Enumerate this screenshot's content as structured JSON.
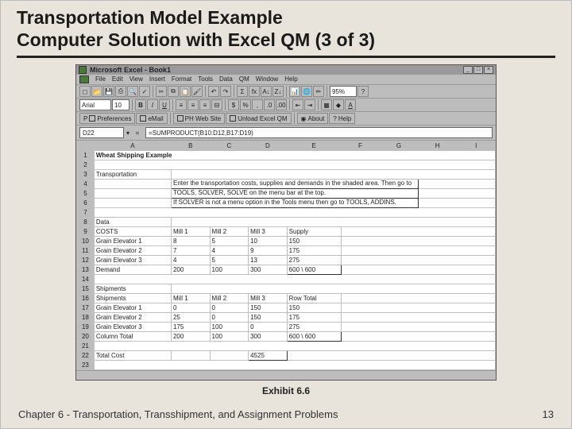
{
  "slide": {
    "title_line1": "Transportation Model Example",
    "title_line2": "Computer Solution with Excel QM (3 of 3)",
    "exhibit": "Exhibit 6.6",
    "footer_left": "Chapter 6 - Transportation, Transshipment, and Assignment Problems",
    "footer_right": "13"
  },
  "excel": {
    "app_title": "Microsoft Excel - Book1",
    "menu": [
      "File",
      "Edit",
      "View",
      "Insert",
      "Format",
      "Tools",
      "Data",
      "QM",
      "Window",
      "Help"
    ],
    "zoom": "95%",
    "font_name": "Arial",
    "font_size": "10",
    "links": {
      "preferences": "Preferences",
      "email": "eMail",
      "ph": "PH Web Site",
      "excel": "Unload Excel QM",
      "about": "About",
      "help": "Help"
    },
    "cell_ref": "D22",
    "formula": "=SUMPRODUCT(B10:D12,B17:D19)",
    "cols": [
      "A",
      "B",
      "C",
      "D",
      "E",
      "F",
      "G",
      "H",
      "I"
    ],
    "rows": {
      "1": {
        "A": "Wheat Shipping Example",
        "bold": true
      },
      "3": {
        "A": "Transportation"
      },
      "4": {
        "B": "Enter the transportation costs, supplies and demands in the shaded area. Then go to"
      },
      "5": {
        "B": "TOOLS, SOLVER, SOLVE on the menu bar at the top."
      },
      "6": {
        "B": "If SOLVER is not a menu option in the Tools menu then go to TOOLS, ADDINS."
      },
      "8": {
        "A": "Data"
      },
      "9": {
        "A": "COSTS",
        "B": "Mill 1",
        "C": "Mill 2",
        "D": "Mill 3",
        "E": "Supply"
      },
      "10": {
        "A": "Grain Elevator 1",
        "B": "8",
        "C": "5",
        "D": "10",
        "E": "150"
      },
      "11": {
        "A": "Grain Elevator 2",
        "B": "7",
        "C": "4",
        "D": "9",
        "E": "175"
      },
      "12": {
        "A": "Grain Elevator 3",
        "B": "4",
        "C": "5",
        "D": "13",
        "E": "275"
      },
      "13": {
        "A": "Demand",
        "B": "200",
        "C": "100",
        "D": "300",
        "E": "600 \\ 600"
      },
      "15": {
        "A": "Shipments"
      },
      "16": {
        "A": "Shipments",
        "B": "Mill 1",
        "C": "Mill 2",
        "D": "Mill 3",
        "E": "Row Total"
      },
      "17": {
        "A": "Grain Elevator 1",
        "B": "0",
        "C": "0",
        "D": "150",
        "E": "150"
      },
      "18": {
        "A": "Grain Elevator 2",
        "B": "25",
        "C": "0",
        "D": "150",
        "E": "175"
      },
      "19": {
        "A": "Grain Elevator 3",
        "B": "175",
        "C": "100",
        "D": "0",
        "E": "275"
      },
      "20": {
        "A": "Column Total",
        "B": "200",
        "C": "100",
        "D": "300",
        "E": "600 \\ 600"
      },
      "22": {
        "A": "Total Cost",
        "D": "4525"
      }
    }
  }
}
